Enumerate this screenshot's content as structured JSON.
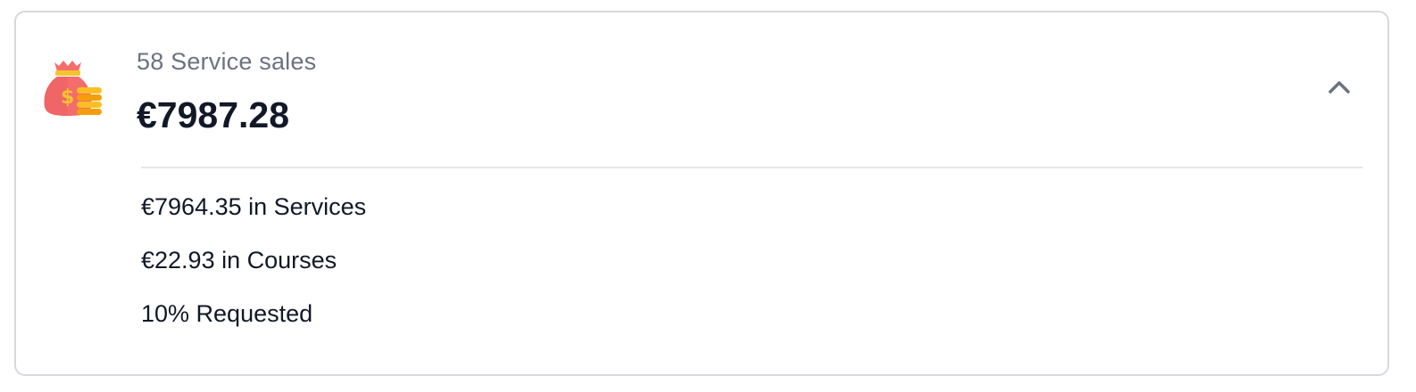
{
  "summary": {
    "subtitle": "58 Service sales",
    "amount": "€7987.28",
    "icon": "money-bag-icon",
    "toggle_icon": "chevron-up-icon"
  },
  "details": {
    "items": [
      {
        "label": "€7964.35 in Services"
      },
      {
        "label": "€22.93 in Courses"
      },
      {
        "label": "10% Requested"
      }
    ]
  },
  "colors": {
    "bag": "#f56c6c",
    "bag_tie": "#f4c430",
    "coins": "#fbbf24",
    "text_primary": "#111827",
    "text_secondary": "#6b7280",
    "border": "#d6d8dc"
  }
}
